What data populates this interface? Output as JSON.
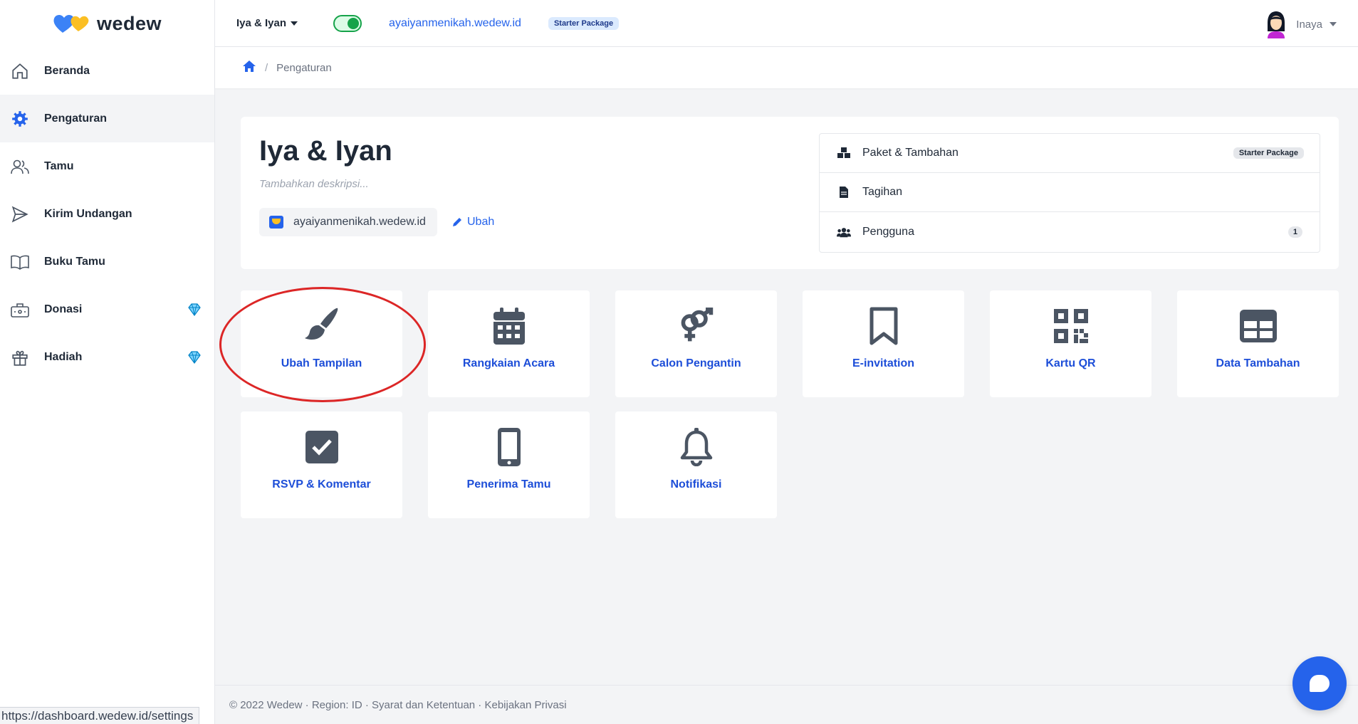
{
  "brand": {
    "name": "wedew"
  },
  "sidebar": {
    "items": [
      {
        "label": "Beranda",
        "icon": "home-icon",
        "active": false,
        "premium": false
      },
      {
        "label": "Pengaturan",
        "icon": "gear-icon",
        "active": true,
        "premium": false
      },
      {
        "label": "Tamu",
        "icon": "users-icon",
        "active": false,
        "premium": false
      },
      {
        "label": "Kirim Undangan",
        "icon": "send-icon",
        "active": false,
        "premium": false
      },
      {
        "label": "Buku Tamu",
        "icon": "book-icon",
        "active": false,
        "premium": false
      },
      {
        "label": "Donasi",
        "icon": "donation-icon",
        "active": false,
        "premium": true
      },
      {
        "label": "Hadiah",
        "icon": "gift-icon",
        "active": false,
        "premium": true
      }
    ]
  },
  "topbar": {
    "event_name": "Iya & Iyan",
    "published": true,
    "domain": "ayaiyanmenikah.wedew.id",
    "package": "Starter Package",
    "user_name": "Inaya"
  },
  "breadcrumb": {
    "current": "Pengaturan"
  },
  "event": {
    "title": "Iya & Iyan",
    "description_placeholder": "Tambahkan deskripsi...",
    "domain": "ayaiyanmenikah.wedew.id",
    "edit_label": "Ubah"
  },
  "side_list": {
    "package_label": "Paket & Tambahan",
    "package_badge": "Starter Package",
    "billing_label": "Tagihan",
    "users_label": "Pengguna",
    "users_count": "1"
  },
  "tiles": [
    {
      "label": "Ubah Tampilan",
      "icon": "paintbrush-icon"
    },
    {
      "label": "Rangkaian Acara",
      "icon": "calendar-icon"
    },
    {
      "label": "Calon Pengantin",
      "icon": "gender-icon"
    },
    {
      "label": "E-invitation",
      "icon": "bookmark-icon"
    },
    {
      "label": "Kartu QR",
      "icon": "qrcode-icon"
    },
    {
      "label": "Data Tambahan",
      "icon": "table-icon"
    },
    {
      "label": "RSVP & Komentar",
      "icon": "checkbox-icon"
    },
    {
      "label": "Penerima Tamu",
      "icon": "mobile-icon"
    },
    {
      "label": "Notifikasi",
      "icon": "bell-icon"
    }
  ],
  "footer": {
    "text": "© 2022 Wedew · Region: ID · Syarat dan Ketentuan · Kebijakan Privasi"
  },
  "status_bar": {
    "url": "https://dashboard.wedew.id/settings"
  },
  "colors": {
    "accent": "#2563eb",
    "tile_icon": "#4b5563",
    "highlight": "#dc2626"
  }
}
